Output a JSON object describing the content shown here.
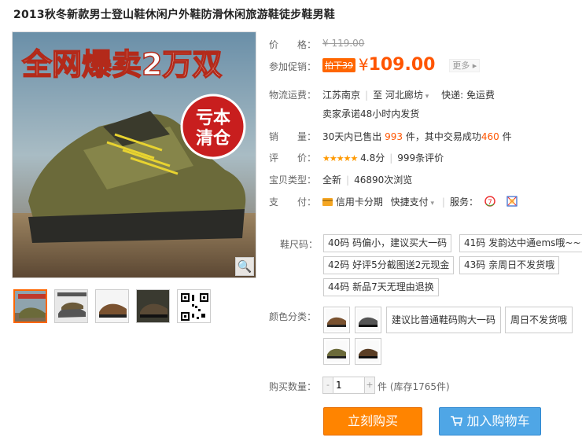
{
  "title": "2013秋冬新款男士登山鞋休闲户外鞋防滑休闲旅游鞋徒步鞋男鞋",
  "banner": {
    "headline": "全网爆卖2万双",
    "badge_line1": "亏本",
    "badge_line2": "清仓"
  },
  "price": {
    "label": "价　　格：",
    "original": "¥ 119.00"
  },
  "promo": {
    "label": "参加促销：",
    "tag": "拍下39",
    "yen": "¥",
    "price": "109.00",
    "more": "更多 ▸"
  },
  "shipping": {
    "label": "物流运费：",
    "from": "江苏南京",
    "to_prefix": "至",
    "to": "河北廊坊",
    "method": "快递: 免运费",
    "promise": "卖家承诺48小时内发货"
  },
  "sales": {
    "label": "销　　量：",
    "prefix": "30天内已售出",
    "sold": "993",
    "mid": "件，其中交易成功",
    "success": "460",
    "suffix": "件"
  },
  "rating": {
    "label": "评　　价：",
    "stars": "★★★★★",
    "score": "4.8分",
    "reviews": "999条评价"
  },
  "item_type": {
    "label": "宝贝类型：",
    "condition": "全新",
    "views": "46890次浏览"
  },
  "payment": {
    "label": "支　　付：",
    "credit": "信用卡分期",
    "quick": "快捷支付",
    "service_label": "服务："
  },
  "size": {
    "label": "鞋尺码：",
    "options": [
      "40码 码偏小，建议买大一码",
      "41码 发韵达中通ems哦~~",
      "42码 好评5分截图送2元现金",
      "43码 亲周日不发货哦",
      "44码 新品7天无理由退换"
    ]
  },
  "color": {
    "label": "颜色分类：",
    "text_options": [
      "建议比普通鞋码购大一码",
      "周日不发货哦"
    ]
  },
  "quantity": {
    "label": "购买数量：",
    "value": "1",
    "minus": "-",
    "plus": "+",
    "stock": "件 (库存1765件)"
  },
  "buttons": {
    "buy_now": "立刻购买",
    "add_cart": "加入购物车"
  },
  "colors": {
    "accent": "#ff5500",
    "buy": "#ff8400",
    "cart": "#4fa6e6"
  }
}
